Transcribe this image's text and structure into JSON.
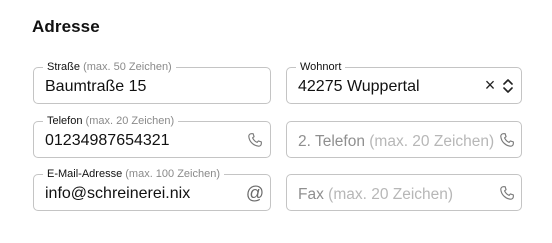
{
  "section": {
    "title": "Adresse"
  },
  "fields": {
    "strasse": {
      "label": "Straße",
      "hint": "(max. 50 Zeichen)",
      "value": "Baumtraße 15"
    },
    "wohnort": {
      "label": "Wohnort",
      "value": "42275 Wuppertal",
      "clear_glyph": "×"
    },
    "telefon": {
      "label": "Telefon",
      "hint": "(max. 20 Zeichen)",
      "value": "01234987654321",
      "icon": "phone-icon"
    },
    "telefon2": {
      "placeholder_label": "2. Telefon",
      "placeholder_hint": "(max. 20 Zeichen)",
      "icon": "phone-icon"
    },
    "email": {
      "label": "E-Mail-Adresse",
      "hint": "(max. 100 Zeichen)",
      "value": "info@schreinerei.nix",
      "icon_glyph": "@"
    },
    "fax": {
      "placeholder_label": "Fax",
      "placeholder_hint": "(max. 20 Zeichen)",
      "icon": "phone-icon"
    }
  }
}
